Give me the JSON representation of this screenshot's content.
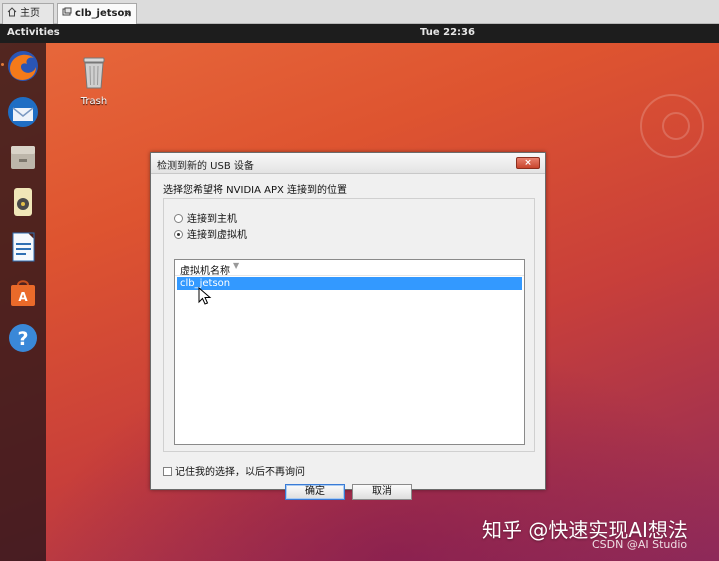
{
  "host_tabs": [
    {
      "label": "主页",
      "icon": "home-icon"
    },
    {
      "label": "clb_jetson",
      "icon": "vm-icon",
      "close": "×"
    }
  ],
  "topbar": {
    "activities": "Activities",
    "clock": "Tue 22:36"
  },
  "dock": {
    "apps": [
      "firefox-icon",
      "thunderbird-icon",
      "files-icon",
      "rhythmbox-icon",
      "libreoffice-writer-icon",
      "software-center-icon",
      "help-icon"
    ]
  },
  "desktop": {
    "trash_label": "Trash"
  },
  "dialog": {
    "title": "检测到新的 USB 设备",
    "close": "×",
    "prompt": "选择您希望将 NVIDIA APX 连接到的位置",
    "options": [
      {
        "label": "连接到主机",
        "selected": false
      },
      {
        "label": "连接到虚拟机",
        "selected": true
      }
    ],
    "list": {
      "header": "虚拟机名称",
      "rows": [
        "clb_jetson"
      ],
      "selected_row": "clb_jetson"
    },
    "remember_label": "记住我的选择，以后不再询问",
    "remember_checked": false,
    "ok_label": "确定",
    "cancel_label": "取消"
  },
  "overlay": {
    "watermark": "知乎 @快速实现AI想法",
    "source": "CSDN @AI Studio"
  },
  "colors": {
    "selection": "#3399ff",
    "topbar": "#1d1d1d",
    "wallpaper": "#de5430"
  }
}
